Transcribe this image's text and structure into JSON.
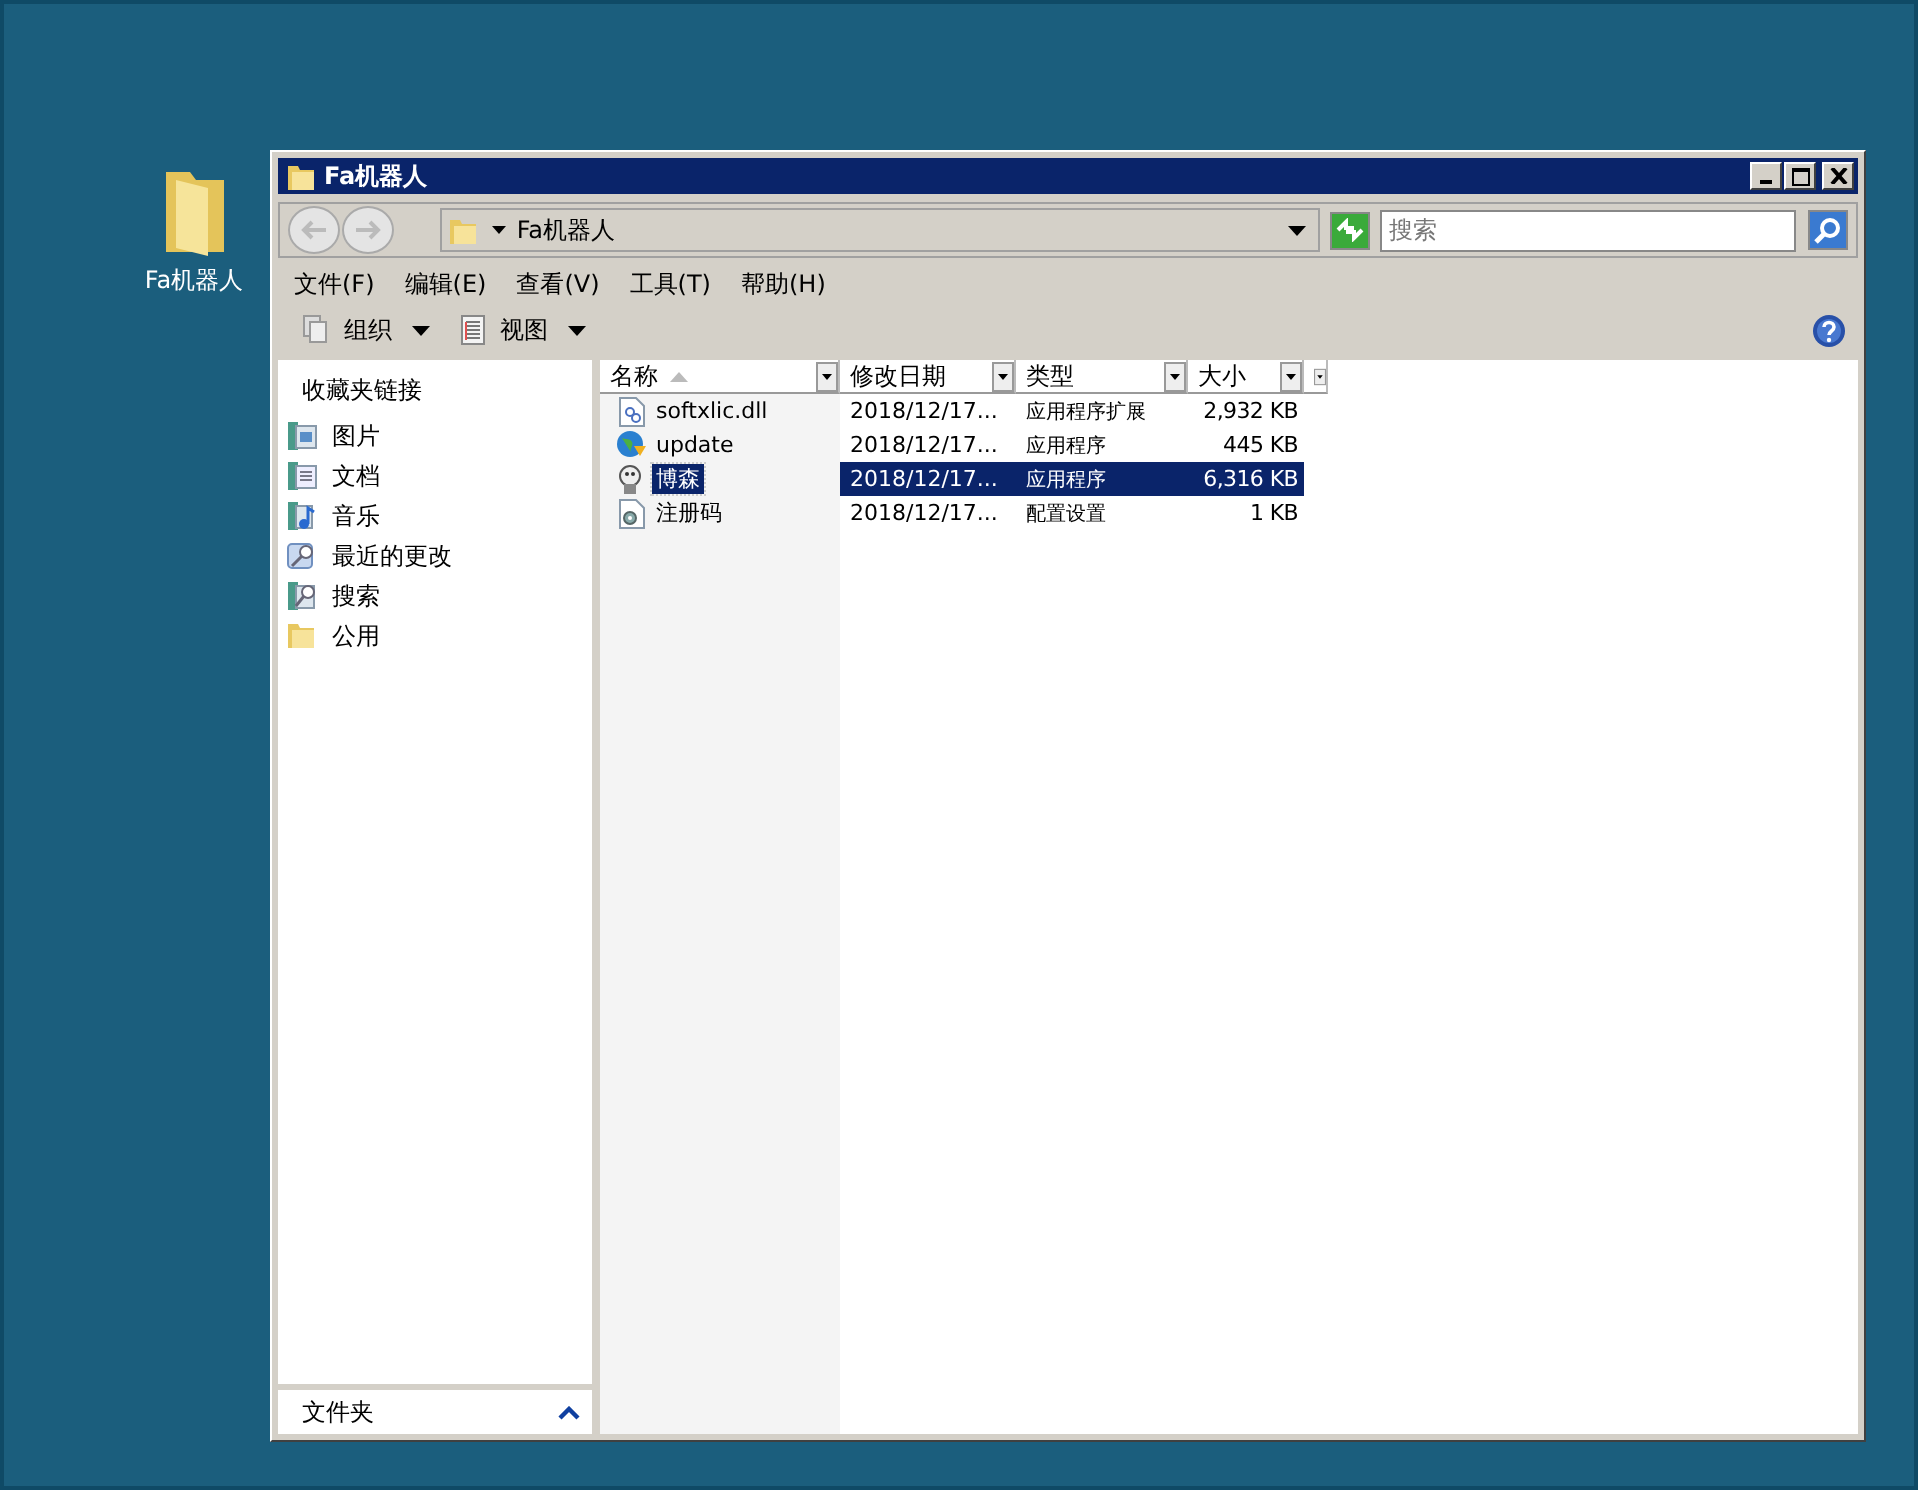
{
  "desktop_icons": [
    {
      "label": "Fa机器人"
    }
  ],
  "window": {
    "title": "Fa机器人"
  },
  "address_bar": {
    "path": "Fa机器人"
  },
  "search": {
    "placeholder": "搜索"
  },
  "menu": [
    "文件(F)",
    "编辑(E)",
    "查看(V)",
    "工具(T)",
    "帮助(H)"
  ],
  "toolbar": [
    {
      "label": "组织",
      "kind": "organize"
    },
    {
      "label": "视图",
      "kind": "views"
    }
  ],
  "sidebar": {
    "title": "收藏夹链接",
    "items": [
      {
        "label": "图片",
        "kind": "pictures"
      },
      {
        "label": "文档",
        "kind": "documents"
      },
      {
        "label": "音乐",
        "kind": "music"
      },
      {
        "label": "最近的更改",
        "kind": "recent"
      },
      {
        "label": "搜索",
        "kind": "search"
      },
      {
        "label": "公用",
        "kind": "folder"
      }
    ],
    "folders_label": "文件夹"
  },
  "table": {
    "columns": [
      {
        "label": "名称",
        "sorted": true
      },
      {
        "label": "修改日期",
        "sorted": false
      },
      {
        "label": "类型",
        "sorted": false
      },
      {
        "label": "大小",
        "sorted": false
      }
    ],
    "rows": [
      {
        "name": "softxlic.dll",
        "date": "2018/12/17...",
        "type": "应用程序扩展",
        "size": "2,932 KB",
        "kind": "dll",
        "selected": false
      },
      {
        "name": "update",
        "date": "2018/12/17...",
        "type": "应用程序",
        "size": "445 KB",
        "kind": "globe",
        "selected": false
      },
      {
        "name": "博森",
        "date": "2018/12/17...",
        "type": "应用程序",
        "size": "6,316 KB",
        "kind": "app",
        "selected": true
      },
      {
        "name": "注册码",
        "date": "2018/12/17...",
        "type": "配置设置",
        "size": "1 KB",
        "kind": "config",
        "selected": false
      }
    ]
  }
}
